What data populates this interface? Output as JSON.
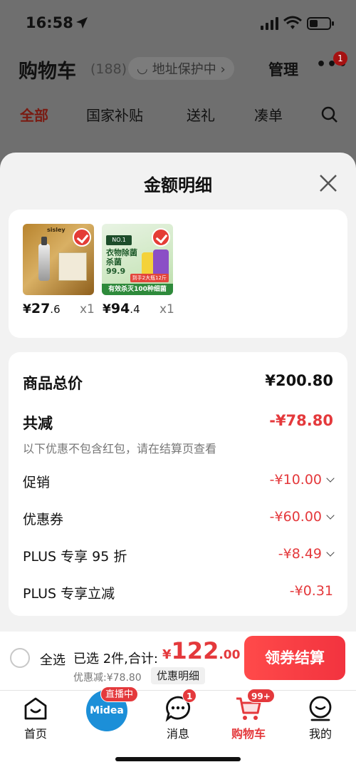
{
  "status": {
    "time": "16:58"
  },
  "header": {
    "title": "购物车",
    "count": "(188)",
    "address": "地址保护中 ›",
    "manage": "管理",
    "more": "•••",
    "more_badge": "1"
  },
  "tabs": [
    {
      "label": "全部"
    },
    {
      "label": "国家补贴"
    },
    {
      "label": "送礼"
    },
    {
      "label": "凑单"
    }
  ],
  "sheet": {
    "title": "金额明细",
    "products": [
      {
        "brand": "sisley",
        "price_yen": "¥",
        "price_int": "27",
        "price_dec": ".6",
        "qty": "x1"
      },
      {
        "badge": "NO.1",
        "text": "衣物除菌 杀菌99.9",
        "ribbon": "有效杀灭100种细菌",
        "tag": "到手2大瓶12斤",
        "price_yen": "¥",
        "price_int": "94",
        "price_dec": ".4",
        "qty": "x1"
      }
    ],
    "rows": {
      "total_label": "商品总价",
      "total_value": "¥200.80",
      "reduce_label": "共减",
      "reduce_value": "-¥78.80",
      "note": "以下优惠不包含红包，请在结算页查看",
      "promo_label": "促销",
      "promo_value": "-¥10.00",
      "coupon_label": "优惠券",
      "coupon_value": "-¥60.00",
      "plus95_label": "PLUS 专享 95 折",
      "plus95_value": "-¥8.49",
      "plusoff_label": "PLUS 专享立减",
      "plusoff_value": "-¥0.31"
    }
  },
  "bottom": {
    "select_all": "全选",
    "picked": "已选 2件,合计:",
    "total_yen": "¥",
    "total_int": "122",
    "total_dec": ".00",
    "discount": "优惠减:¥78.80",
    "detail": "优惠明细",
    "checkout": "领券结算"
  },
  "nav": {
    "home": "首页",
    "live_logo": "Midea",
    "live_badge": "直播中",
    "message": "消息",
    "message_badge": "1",
    "cart": "购物车",
    "cart_badge": "99+",
    "mine": "我的"
  },
  "colors": {
    "accent": "#e4393c",
    "checkout": "#f2333f"
  }
}
